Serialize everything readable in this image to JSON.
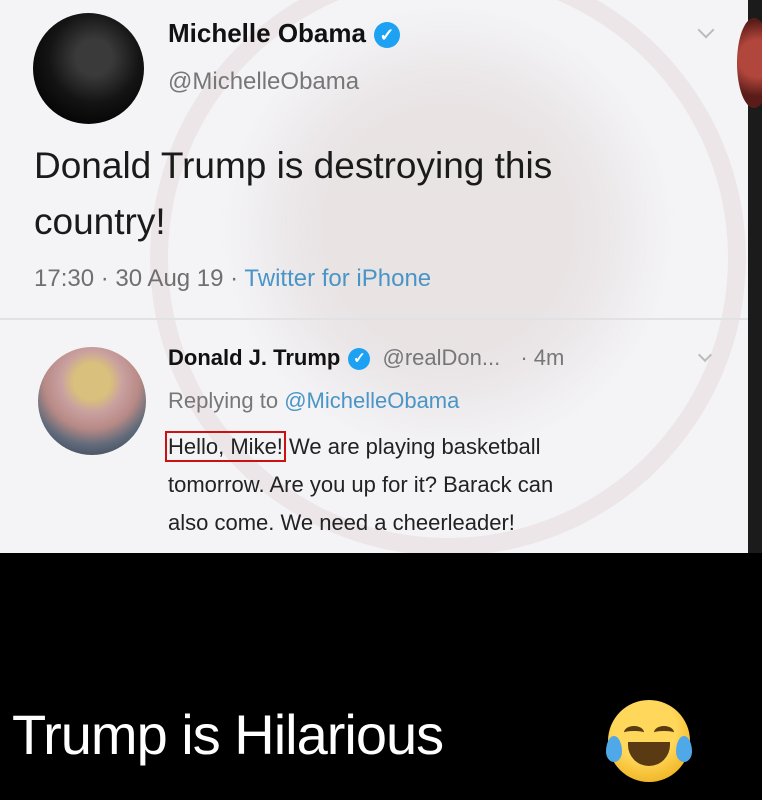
{
  "tweet1": {
    "name": "Michelle Obama",
    "handle": "@MichelleObama",
    "text_line1": "Donald Trump is destroying this",
    "text_line2": "country!",
    "time": "17:30",
    "date": "30 Aug 19",
    "source": "Twitter for iPhone",
    "sep": " · "
  },
  "reply": {
    "name": "Donald J. Trump",
    "handle": "@realDon...",
    "age": "· 4m",
    "replying_prefix": "Replying to ",
    "replying_handle": "@MichelleObama",
    "boxed_text": "Hello, Mike!",
    "text_line1_rest": "We are playing basketball",
    "text_line2": "tomorrow. Are you up for it? Barack can",
    "text_line3": "also come. We need a cheerleader!"
  },
  "caption": {
    "text": "Trump is Hilarious"
  },
  "icons": {
    "verified": "verified-badge-icon",
    "more": "chevron-down-icon",
    "emoji": "face-with-tears-of-joy-icon"
  },
  "colors": {
    "verified": "#1da1f2",
    "link": "#4a95c7",
    "highlight_box": "#cc1111"
  }
}
